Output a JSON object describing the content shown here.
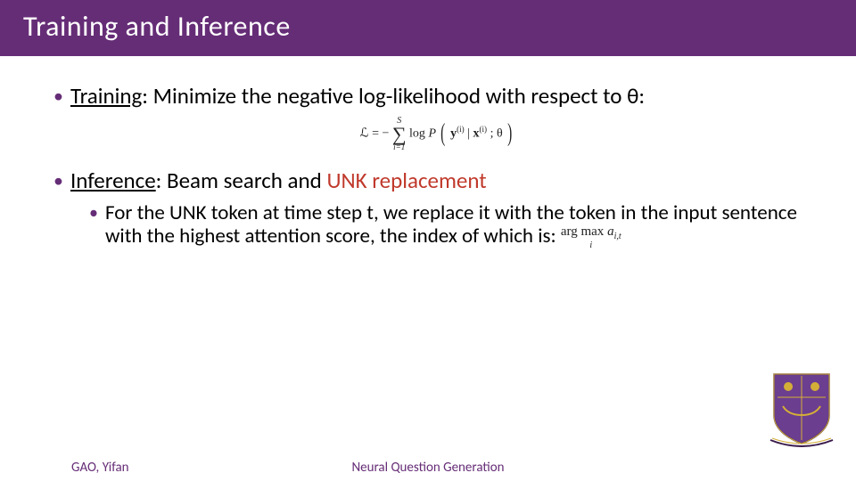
{
  "title": "Training and Inference",
  "b1_label": "Training",
  "b1_rest": ": Minimize the negative log-likelihood with respect to θ:",
  "formula": {
    "lhs": "ℒ = −",
    "sum_top": "S",
    "sum_bot": "i=1",
    "log": "log ",
    "p": "P ",
    "y": "y",
    "sup_i": "(i)",
    "bar": "|",
    "x": "x",
    "theta": "; θ"
  },
  "b2_label": "Inference",
  "b2_rest": ": Beam search and ",
  "b2_unk": "UNK replacement",
  "sb_text": "For the UNK token at time step t, we replace it with the token in the input sentence with the highest attention score, the index of which is:  ",
  "argmax_top": "arg max",
  "argmax_bot": "i",
  "argmax_var": " a",
  "argmax_sub": "i,t",
  "footer_name": "GAO, Yifan",
  "footer_project": "Neural Question Generation",
  "colors": {
    "accent": "#662d77",
    "unk": "#c0392b"
  }
}
